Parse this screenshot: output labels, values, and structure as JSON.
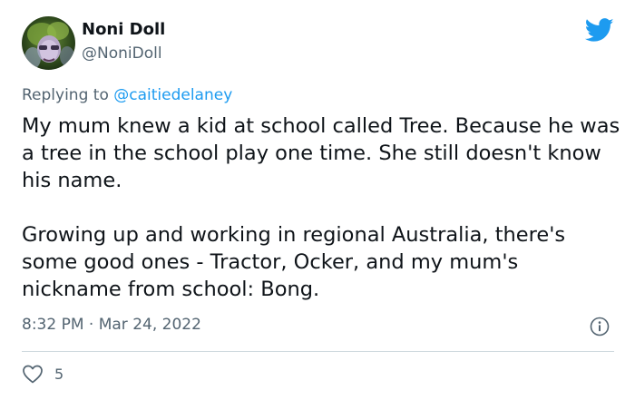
{
  "author": {
    "display_name": "Noni Doll",
    "handle": "@NoniDoll"
  },
  "brand_icon": "twitter-bird-icon",
  "reply": {
    "prefix": "Replying to ",
    "mention": "@caitiedelaney"
  },
  "body": {
    "paragraph_1": "My mum knew a kid at school called Tree. Because he was a tree in the school play one time. She still doesn't know his name.",
    "paragraph_2": "Growing up and working in regional Australia, there's some good ones - Tractor, Ocker, and my mum's nickname from school: Bong."
  },
  "meta": {
    "time": "8:32 PM",
    "separator": " · ",
    "date": "Mar 24, 2022"
  },
  "engagement": {
    "like_count": "5"
  },
  "colors": {
    "accent": "#1d9bf0",
    "text_primary": "#0f1419",
    "text_secondary": "#536471",
    "divider": "#cfd9de"
  }
}
